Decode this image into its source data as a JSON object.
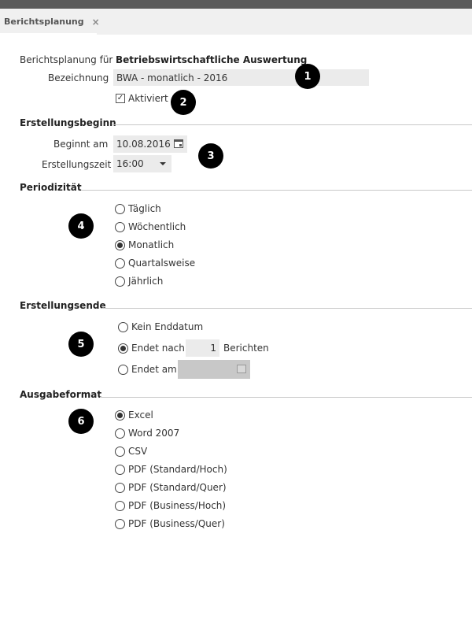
{
  "tab": {
    "label": "Berichtsplanung",
    "close_glyph": "×"
  },
  "general": {
    "label_for": "Berichtsplanung für",
    "report_name": "Betriebswirtschaftliche Auswertung",
    "label_name": "Bezeichnung",
    "name_value": "BWA - monatlich - 2016",
    "active_label": "Aktiviert",
    "active_checked": true
  },
  "start": {
    "title": "Erstellungsbeginn",
    "begin_label": "Beginnt am",
    "begin_value": "10.08.2016",
    "time_label": "Erstellungszeit",
    "time_value": "16:00"
  },
  "periodicity": {
    "title": "Periodizität",
    "options": [
      "Täglich",
      "Wöchentlich",
      "Monatlich",
      "Quartalsweise",
      "Jährlich"
    ],
    "selected": "Monatlich"
  },
  "end": {
    "title": "Erstellungsende",
    "no_end": "Kein Enddatum",
    "ends_after": "Endet nach",
    "count": "1",
    "reports_suffix": "Berichten",
    "ends_on": "Endet am",
    "selected": "Endet nach"
  },
  "output": {
    "title": "Ausgabeformat",
    "options": [
      "Excel",
      "Word 2007",
      "CSV",
      "PDF (Standard/Hoch)",
      "PDF (Standard/Quer)",
      "PDF (Business/Hoch)",
      "PDF (Business/Quer)"
    ],
    "selected": "Excel"
  },
  "badges": [
    "1",
    "2",
    "3",
    "4",
    "5",
    "6"
  ]
}
